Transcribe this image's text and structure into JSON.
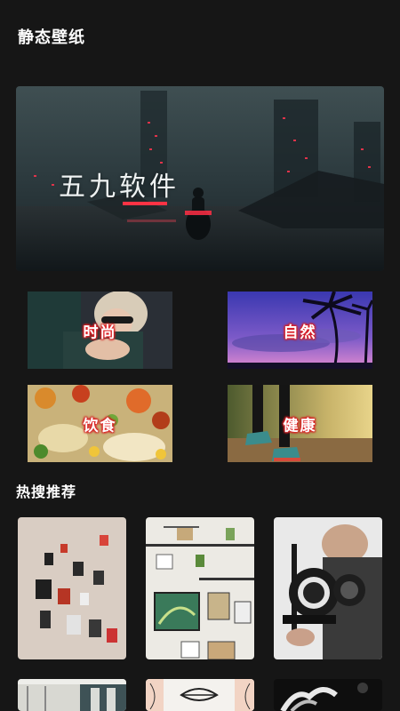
{
  "header": {
    "title": "静态壁纸"
  },
  "banner": {
    "text": "五九软件"
  },
  "categories": [
    {
      "label": "时尚"
    },
    {
      "label": "自然"
    },
    {
      "label": "饮食"
    },
    {
      "label": "健康"
    }
  ],
  "hot": {
    "title": "热搜推荐"
  }
}
